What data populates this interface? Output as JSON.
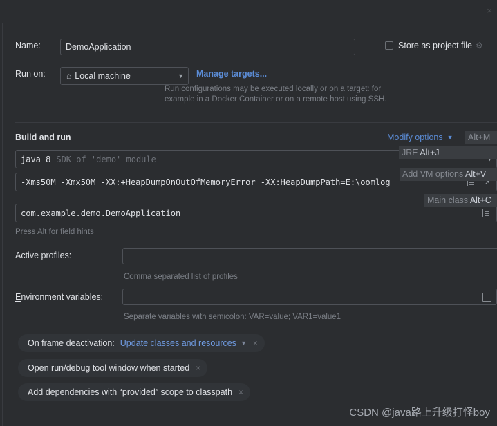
{
  "window": {
    "close_label": "×"
  },
  "form": {
    "name_label": "Name:",
    "name_label_mnemonic": "N",
    "name_value": "DemoApplication",
    "store_as_project_file_label": "Store as project file",
    "store_as_project_file_mnemonic": "S",
    "store_as_project_file_checked": false,
    "run_on_label": "Run on:",
    "run_on_value": "Local machine",
    "run_on_icon": "home-icon",
    "manage_targets_label": "Manage targets...",
    "run_on_description_line1": "Run configurations may be executed locally or on a target: for",
    "run_on_description_line2": "example in a Docker Container or on a remote host using SSH."
  },
  "build_and_run": {
    "section_title": "Build and run",
    "modify_options_label": "Modify options",
    "modify_options_mnemonic": "M",
    "jre_value_main": "java 8",
    "jre_value_hint": "SDK of 'demo' module",
    "vm_options_value": "-Xms50M -Xmx50M -XX:+HeapDumpOnOutOfMemoryError -XX:HeapDumpPath=E:\\oomlog",
    "main_class_value": "com.example.demo.DemoApplication",
    "press_alt_hint": "Press Alt for field hints"
  },
  "alt_hints": [
    {
      "name": "modify-options",
      "text": "Alt+M"
    },
    {
      "name": "jre",
      "label": "JRE ",
      "key": "Alt+J"
    },
    {
      "name": "add-vm-options",
      "label": "Add VM options ",
      "key": "Alt+V"
    },
    {
      "name": "main-class",
      "label": "Main class ",
      "key": "Alt+C"
    }
  ],
  "spring": {
    "active_profiles_label": "Active profiles:",
    "active_profiles_value": "",
    "active_profiles_hint": "Comma separated list of profiles",
    "environment_variables_label": "Environment variables:",
    "environment_variables_mnemonic": "E",
    "environment_variables_value": "",
    "environment_variables_hint": "Separate variables with semicolon: VAR=value; VAR1=value1"
  },
  "chips": [
    {
      "name": "on-frame-deactivation",
      "label": "On frame deactivation:",
      "mnemonic": "f",
      "value": "Update classes and resources",
      "has_dropdown": true,
      "close_label": "×"
    },
    {
      "name": "open-run-debug-tool-window",
      "label": "Open run/debug tool window when started",
      "has_dropdown": false,
      "close_label": "×"
    },
    {
      "name": "add-provided-dependencies",
      "label": "Add dependencies with “provided” scope to classpath",
      "has_dropdown": false,
      "close_label": "×"
    }
  ],
  "watermark": {
    "text": "CSDN @java路上升级打怪boy"
  },
  "colors": {
    "background": "#2b2d30",
    "field_border": "#4e5157",
    "link": "#5b8cd6",
    "hint_text": "#7a7e85",
    "chip_background": "#313438"
  }
}
